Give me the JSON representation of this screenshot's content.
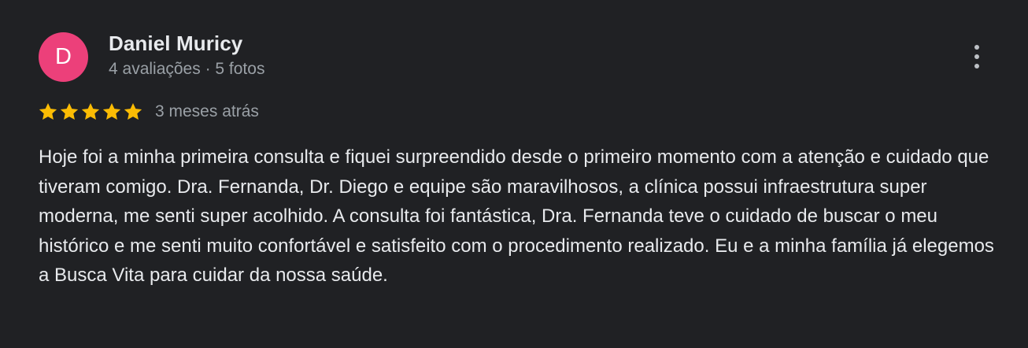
{
  "review": {
    "author": {
      "initial": "D",
      "name": "Daniel Muricy",
      "meta": "4 avaliações · 5 fotos",
      "avatar_color": "#ec407a"
    },
    "rating": 5,
    "max_rating": 5,
    "star_color": "#fbbc04",
    "date": "3 meses atrás",
    "text": "Hoje foi a minha primeira consulta e fiquei surpreendido desde o primeiro momento com a atenção e cuidado que tiveram comigo. Dra. Fernanda, Dr. Diego e equipe são maravilhosos, a clínica possui infraestrutura super moderna, me senti super acolhido. A consulta foi fantástica, Dra. Fernanda teve o cuidado de buscar o meu histórico e me senti muito confortável e satisfeito com o procedimento realizado. Eu e a minha família já elegemos a Busca Vita para cuidar da nossa saúde.",
    "more_icon": "more-vert-icon"
  }
}
